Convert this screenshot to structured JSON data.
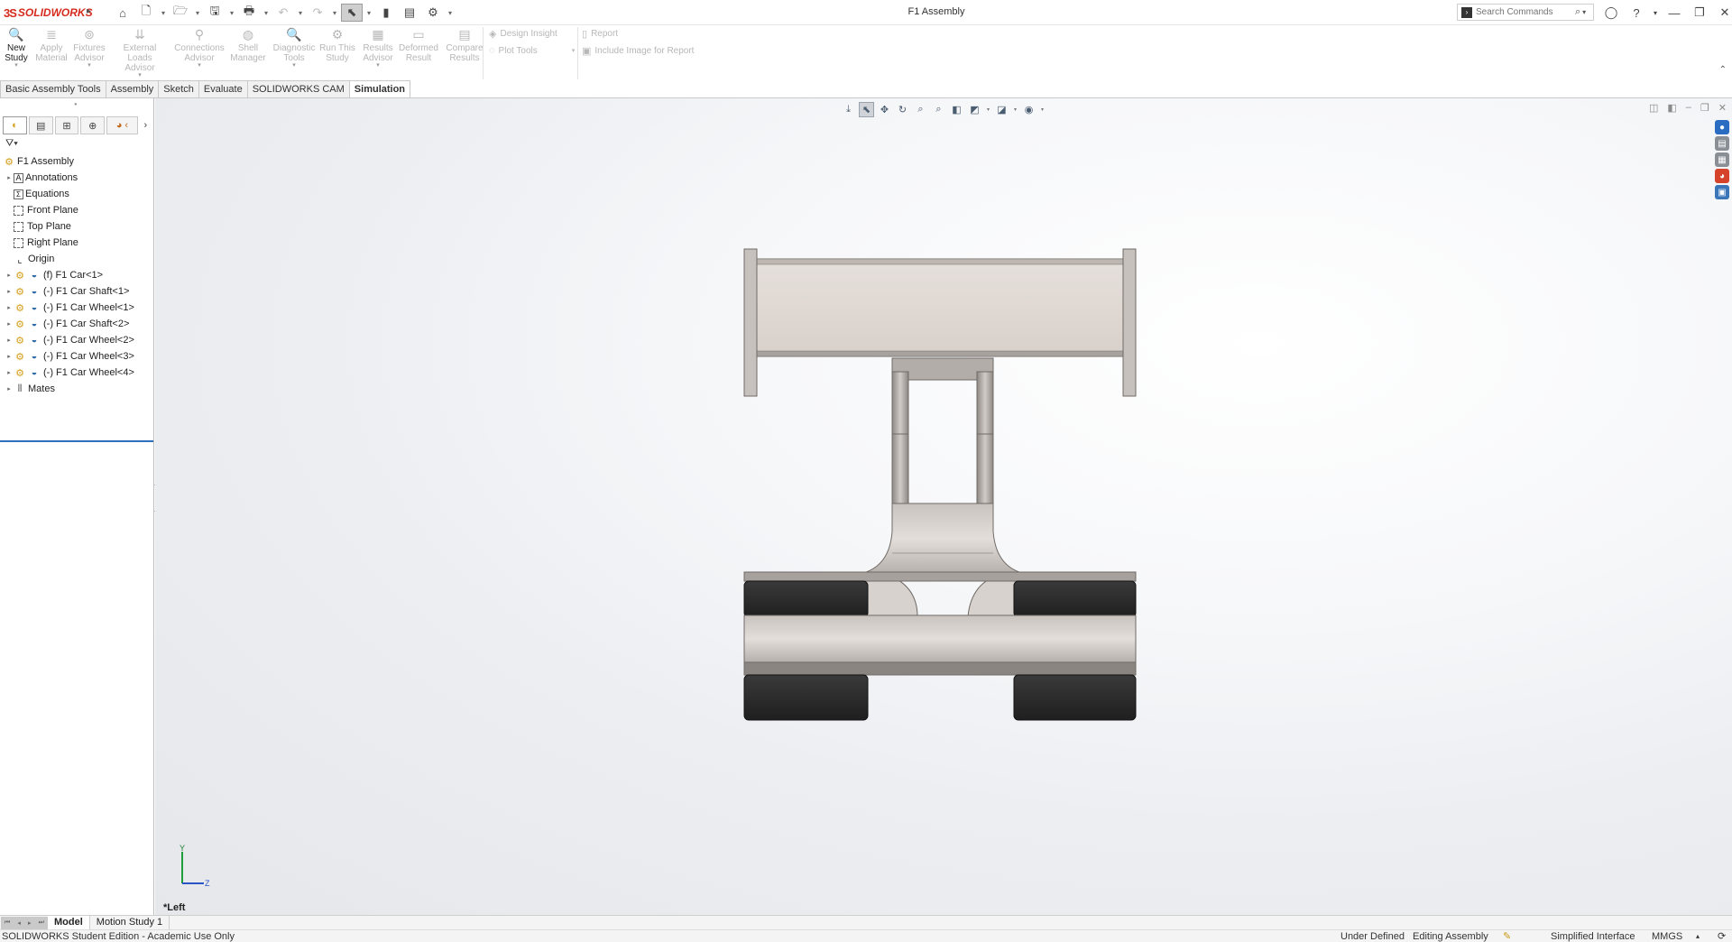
{
  "app": {
    "logo_ds": "3S",
    "logo_name": "SOLIDWORKS",
    "document_title": "F1 Assembly"
  },
  "quick_access": [
    {
      "name": "home-icon",
      "glyph": "⌂"
    },
    {
      "name": "new-document-icon",
      "glyph": "🗋"
    },
    {
      "name": "open-icon",
      "glyph": "📂"
    },
    {
      "name": "save-icon",
      "glyph": "💾"
    },
    {
      "name": "print-icon",
      "glyph": "🖶"
    },
    {
      "name": "undo-icon",
      "glyph": "↶"
    },
    {
      "name": "redo-icon",
      "glyph": "↷"
    },
    {
      "name": "select-icon",
      "glyph": "⬉"
    },
    {
      "name": "rebuild-icon",
      "glyph": "🚦"
    },
    {
      "name": "file-properties-icon",
      "glyph": "▤"
    },
    {
      "name": "options-icon",
      "glyph": "⚙"
    }
  ],
  "search": {
    "placeholder": "Search Commands"
  },
  "title_buttons": [
    {
      "name": "user-account-icon",
      "glyph": "👤"
    },
    {
      "name": "help-icon",
      "glyph": "?"
    },
    {
      "name": "minimize-icon",
      "glyph": "—"
    },
    {
      "name": "restore-icon",
      "glyph": "❐"
    },
    {
      "name": "close-icon",
      "glyph": "✕"
    }
  ],
  "command_manager": {
    "new_study": "New\nStudy",
    "apply_material": "Apply\nMaterial",
    "fixtures_advisor": "Fixtures\nAdvisor",
    "external_loads_advisor": "External Loads\nAdvisor",
    "connections_advisor": "Connections\nAdvisor",
    "shell_manager": "Shell\nManager",
    "diagnostic_tools": "Diagnostic\nTools",
    "run_this_study": "Run This\nStudy",
    "results_advisor": "Results\nAdvisor",
    "deformed_result": "Deformed\nResult",
    "compare_results": "Compare\nResults",
    "design_insight": "Design Insight",
    "plot_tools": "Plot Tools",
    "report": "Report",
    "include_image": "Include Image for Report"
  },
  "tabs": [
    "Basic Assembly Tools",
    "Assembly",
    "Sketch",
    "Evaluate",
    "SOLIDWORKS CAM",
    "Simulation"
  ],
  "active_tab": "Simulation",
  "feature_tree": {
    "root": "F1 Assembly",
    "items": [
      {
        "label": "Annotations",
        "type": "annotations",
        "expandable": true
      },
      {
        "label": "Equations",
        "type": "equations",
        "expandable": false
      },
      {
        "label": "Front Plane",
        "type": "plane",
        "expandable": false
      },
      {
        "label": "Top Plane",
        "type": "plane",
        "expandable": false
      },
      {
        "label": "Right Plane",
        "type": "plane",
        "expandable": false
      },
      {
        "label": "Origin",
        "type": "origin",
        "expandable": false
      },
      {
        "label": "(f) F1 Car<1>",
        "type": "part",
        "expandable": true
      },
      {
        "label": "(-) F1 Car Shaft<1>",
        "type": "part",
        "expandable": true
      },
      {
        "label": "(-) F1 Car Wheel<1>",
        "type": "part",
        "expandable": true
      },
      {
        "label": "(-) F1 Car Shaft<2>",
        "type": "part",
        "expandable": true
      },
      {
        "label": "(-) F1 Car Wheel<2>",
        "type": "part",
        "expandable": true
      },
      {
        "label": "(-) F1 Car Wheel<3>",
        "type": "part",
        "expandable": true
      },
      {
        "label": "(-) F1 Car Wheel<4>",
        "type": "part",
        "expandable": true
      },
      {
        "label": "Mates",
        "type": "mates",
        "expandable": true
      }
    ]
  },
  "viewport": {
    "view_name": "*Left",
    "triad_y": "Y",
    "triad_z": "Z"
  },
  "bottom_tabs": [
    "Model",
    "Motion Study 1"
  ],
  "status": {
    "edition": "SOLIDWORKS Student Edition - Academic Use Only",
    "state": "Under Defined",
    "mode": "Editing Assembly",
    "interface": "Simplified Interface",
    "units": "MMGS"
  },
  "colors": {
    "accent": "#2e6fbd",
    "logo": "#d52b1e",
    "wing": "#ddd6d1",
    "tire": "#2a2a2a"
  }
}
